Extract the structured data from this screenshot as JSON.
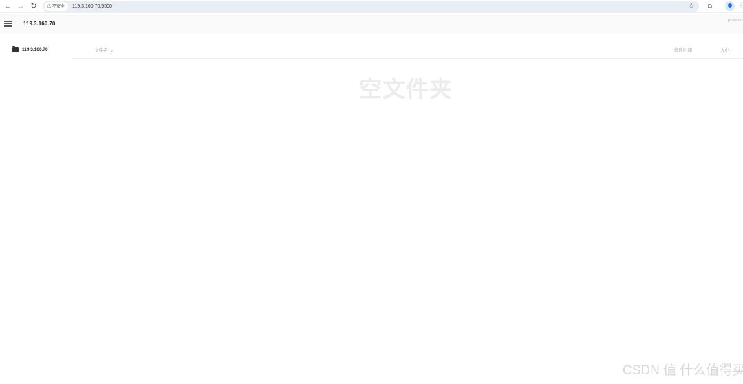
{
  "browser": {
    "security_label": "不安全",
    "url": "119.3.160.70:5500"
  },
  "app": {
    "title": "119.3.160.70",
    "powered_by": "powered by Go"
  },
  "sidebar": {
    "items": [
      {
        "label": "119.3.160.70",
        "icon": "folder-icon"
      }
    ]
  },
  "file_list": {
    "columns": {
      "name": "文件名",
      "modified": "修改时间",
      "size": "大小"
    },
    "empty_message": "空文件夹"
  },
  "watermark": "CSDN 值 什么值得买"
}
